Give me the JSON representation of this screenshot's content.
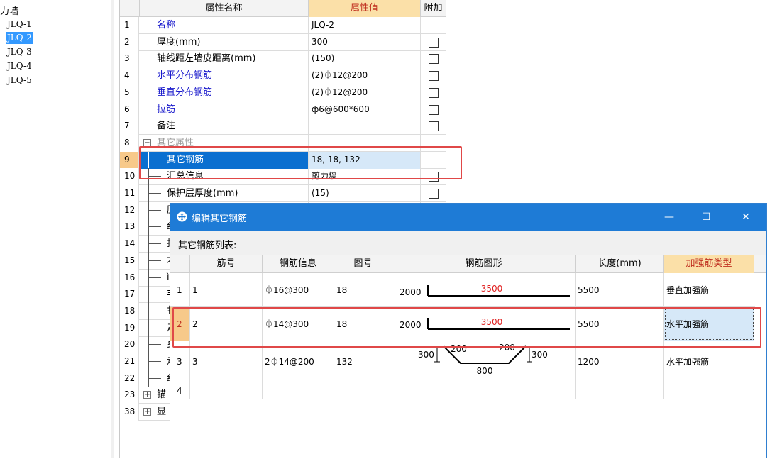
{
  "tree": {
    "root_label": "力墙",
    "items": [
      "JLQ-1",
      "JLQ-2",
      "JLQ-3",
      "JLQ-4",
      "JLQ-5"
    ],
    "selected": "JLQ-2"
  },
  "props": {
    "headers": {
      "name": "属性名称",
      "value": "属性值",
      "extra": "附加"
    },
    "rows": [
      {
        "no": "1",
        "name": "名称",
        "value": "JLQ-2"
      },
      {
        "no": "2",
        "name": "厚度(mm)",
        "value": "300"
      },
      {
        "no": "3",
        "name": "轴线距左墙皮距离(mm)",
        "value": "(150)"
      },
      {
        "no": "4",
        "name": "水平分布钢筋",
        "value": "(2)⏀12@200"
      },
      {
        "no": "5",
        "name": "垂直分布钢筋",
        "value": "(2)⏀12@200"
      },
      {
        "no": "6",
        "name": "拉筋",
        "value": "ф6@600*600"
      },
      {
        "no": "7",
        "name": "备注",
        "value": ""
      },
      {
        "no": "8",
        "name": "其它属性",
        "value": ""
      },
      {
        "no": "9",
        "name": "其它钢筋",
        "value": "18, 18, 132"
      },
      {
        "no": "10",
        "name": "汇总信息",
        "value": "剪力墙"
      },
      {
        "no": "11",
        "name": "保护层厚度(mm)",
        "value": "(15)"
      },
      {
        "no": "12",
        "name": "压",
        "value": ""
      },
      {
        "no": "13",
        "name": "纟",
        "value": ""
      },
      {
        "no": "14",
        "name": "打",
        "value": ""
      },
      {
        "no": "15",
        "name": "才",
        "value": ""
      },
      {
        "no": "16",
        "name": "ì",
        "value": ""
      },
      {
        "no": "17",
        "name": "丰",
        "value": ""
      },
      {
        "no": "18",
        "name": "扌",
        "value": ""
      },
      {
        "no": "19",
        "name": "走",
        "value": ""
      },
      {
        "no": "20",
        "name": "乡",
        "value": ""
      },
      {
        "no": "21",
        "name": "走",
        "value": ""
      },
      {
        "no": "22",
        "name": "纟",
        "value": ""
      },
      {
        "no": "23",
        "name": "锚",
        "value": ""
      },
      {
        "no": "38",
        "name": "显",
        "value": ""
      }
    ],
    "expander_plus": "+",
    "expander_minus": "−"
  },
  "dialog": {
    "title": "编辑其它钢筋",
    "minimize": "—",
    "maximize": "☐",
    "close": "✕",
    "subtitle": "其它钢筋列表:",
    "headers": {
      "bar_no": "筋号",
      "bar_info": "钢筋信息",
      "fig_no": "图号",
      "shape": "钢筋图形",
      "length": "长度(mm)",
      "type": "加强筋类型"
    },
    "rows": [
      {
        "rno": "1",
        "bar_no": "1",
        "bar_info": "⏀16@300",
        "fig_no": "18",
        "shape_left": "2000",
        "shape_top": "3500",
        "length": "5500",
        "type": "垂直加强筋"
      },
      {
        "rno": "2",
        "bar_no": "2",
        "bar_info": "⏀14@300",
        "fig_no": "18",
        "shape_left": "2000",
        "shape_top": "3500",
        "length": "5500",
        "type": "水平加强筋"
      },
      {
        "rno": "3",
        "bar_no": "3",
        "bar_info": "2⏀14@200",
        "fig_no": "132",
        "shape_a": "300",
        "shape_b": "200",
        "shape_c": "200",
        "shape_d": "300",
        "shape_e": "800",
        "length": "1200",
        "type": "水平加强筋"
      },
      {
        "rno": "4",
        "bar_no": "",
        "bar_info": "",
        "fig_no": "",
        "length": "",
        "type": ""
      }
    ]
  },
  "colors": {
    "accent": "#1e7bd6",
    "highlight": "#e04848",
    "gold": "#fbe0a8"
  }
}
